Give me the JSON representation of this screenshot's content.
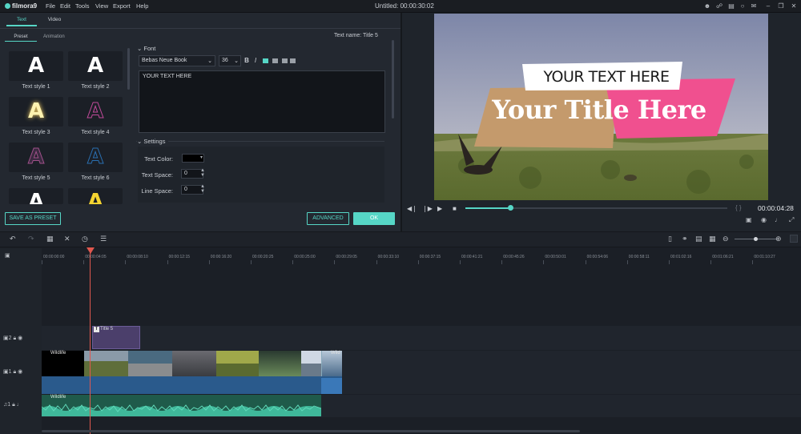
{
  "app": {
    "logo": "filmora9",
    "menu": [
      "File",
      "Edit",
      "Tools",
      "View",
      "Export",
      "Help"
    ],
    "window_title": "Untitled: 00:00:30:02"
  },
  "left_panel": {
    "tabs": [
      "Text",
      "Video"
    ],
    "subtabs": [
      "Preset",
      "Animation"
    ],
    "text_name": "Text name: Title 5",
    "styles": [
      {
        "glyph": "A",
        "label": "Text style 1",
        "color": "#ffffff"
      },
      {
        "glyph": "A",
        "label": "Text style 2",
        "color": "#ffffff"
      },
      {
        "glyph": "A",
        "label": "Text style 3",
        "color": "#fff3b0"
      },
      {
        "glyph": "A",
        "label": "Text style 4",
        "color": "#c04a9a"
      },
      {
        "glyph": "A",
        "label": "Text style 5",
        "color": "#a0508a"
      },
      {
        "glyph": "A",
        "label": "Text style 6",
        "color": "#2a6fb0"
      },
      {
        "glyph": "A",
        "label": "",
        "color": "#ffffff"
      },
      {
        "glyph": "A",
        "label": "",
        "color": "#f5d431"
      }
    ],
    "font_section": "Font",
    "font_family": "Bebas Neue Book",
    "font_size": "36",
    "bold": "B",
    "italic": "I",
    "text_value": "YOUR  TEXT HERE",
    "settings_section": "Settings",
    "settings": {
      "text_color_label": "Text Color:",
      "text_space_label": "Text Space:",
      "text_space_value": "0",
      "line_space_label": "Line Space:",
      "line_space_value": "0"
    },
    "buttons": {
      "save_preset": "SAVE AS PRESET",
      "advanced": "ADVANCED",
      "ok": "OK"
    }
  },
  "preview": {
    "subtitle": "YOUR TEXT HERE",
    "title": "Your Title Here",
    "timecode": "00:00:04:28",
    "progress": 0.17,
    "brackets": "{ }"
  },
  "timeline": {
    "ruler": [
      "00:00:00:00",
      "00:00:04:05",
      "00:00:08:10",
      "00:00:12:15",
      "00:00:16:20",
      "00:00:20:25",
      "00:00:25:00",
      "00:00:29:05",
      "00:00:33:10",
      "00:00:37:15",
      "00:00:41:21",
      "00:00:45:26",
      "00:00:50:01",
      "00:00:54:06",
      "00:00:58:11",
      "00:01:02:16",
      "00:01:06:21",
      "00:01:10:27"
    ],
    "tracks": [
      {
        "id": "2"
      },
      {
        "id": "1"
      },
      {
        "id": "1"
      }
    ],
    "title_clip": "Title 5",
    "video_clip": "Wildlife",
    "video_clip2": "Wild",
    "audio_clip": "Wildlife"
  },
  "colors": {
    "accent": "#56d6c6",
    "playhead": "#e0584f",
    "title_clip": "#4b3f6b",
    "video_clip": "#2a5a8c",
    "audio_clip": "#1f5a4a",
    "title_bar_pink": "#f0508f",
    "title_bar_tan": "#c49a6c"
  }
}
